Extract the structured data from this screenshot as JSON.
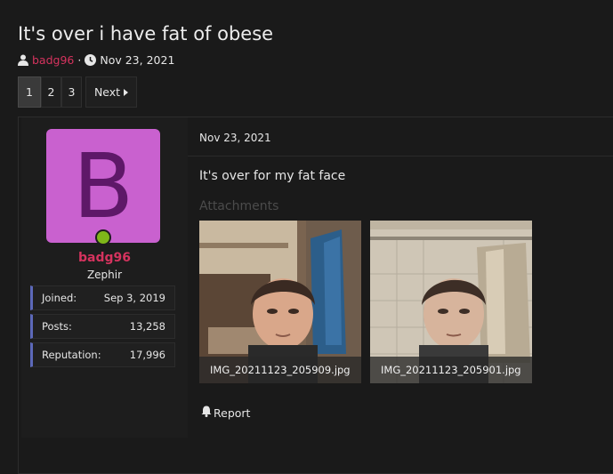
{
  "thread": {
    "title": "It's over i have fat of obese",
    "author": "badg96",
    "separator": "·",
    "date": "Nov 23, 2021"
  },
  "pagination": {
    "pages": [
      "1",
      "2",
      "3"
    ],
    "current": "1",
    "next_label": "Next"
  },
  "user": {
    "avatar_letter": "B",
    "avatar_color": "#c961cf",
    "avatar_letter_color": "#5e1868",
    "online_color": "#7fb719",
    "name": "badg96",
    "name_color": "#d5335e",
    "title": "Zephir",
    "stats": [
      {
        "label": "Joined:",
        "value": "Sep 3, 2019"
      },
      {
        "label": "Posts:",
        "value": "13,258"
      },
      {
        "label": "Reputation:",
        "value": "17,996"
      }
    ]
  },
  "post": {
    "date": "Nov 23, 2021",
    "body": "It's over for my fat face",
    "attachments_label": "Attachments",
    "attachments": [
      {
        "filename": "IMG_20211123_205909.jpg"
      },
      {
        "filename": "IMG_20211123_205901.jpg"
      }
    ],
    "report_label": "Report"
  },
  "icons": {
    "user": "user-icon",
    "clock": "clock-icon",
    "caret": "caret-right-icon",
    "bell": "bell-icon"
  }
}
